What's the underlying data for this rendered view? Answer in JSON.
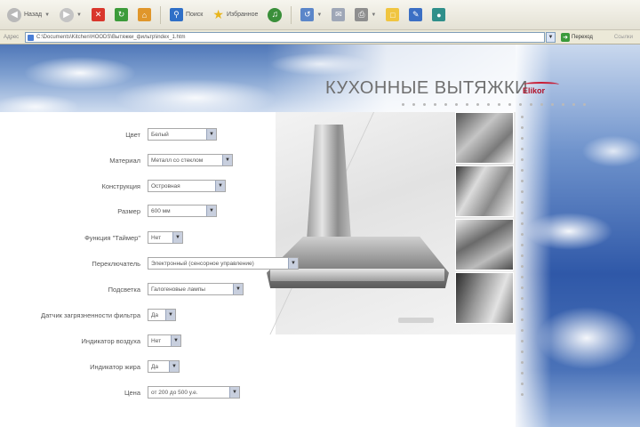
{
  "browser": {
    "toolbar": {
      "back_label": "Назад",
      "search_label": "Поиск",
      "favorites_label": "Избранное"
    },
    "address": {
      "label": "Адрес",
      "url": "C:\\Documents\\Kitchen\\HOODS\\Вытяжки_фильтр\\index_1.htm",
      "go_label": "Переход",
      "links_label": "Ссылки"
    }
  },
  "site": {
    "title": "КУХОННЫЕ ВЫТЯЖКИ",
    "logo_text": "Elikor"
  },
  "filters": [
    {
      "label": "Цвет",
      "value": "Белый"
    },
    {
      "label": "Материал",
      "value": "Металл со стеклом"
    },
    {
      "label": "Конструкция",
      "value": "Островная"
    },
    {
      "label": "Размер",
      "value": "600 мм"
    },
    {
      "label": "Функция \"Таймер\"",
      "value": "Нет"
    },
    {
      "label": "Переключатель",
      "value": "Электронный (сенсорное управление)"
    },
    {
      "label": "Подсветка",
      "value": "Галогеновые лампы"
    },
    {
      "label": "Датчик загрязненности фильтра",
      "value": "Да"
    },
    {
      "label": "Индикатор воздуха",
      "value": "Нет"
    },
    {
      "label": "Индикатор жира",
      "value": "Да"
    },
    {
      "label": "Цена",
      "value": "от 200 до 500 у.е."
    }
  ]
}
